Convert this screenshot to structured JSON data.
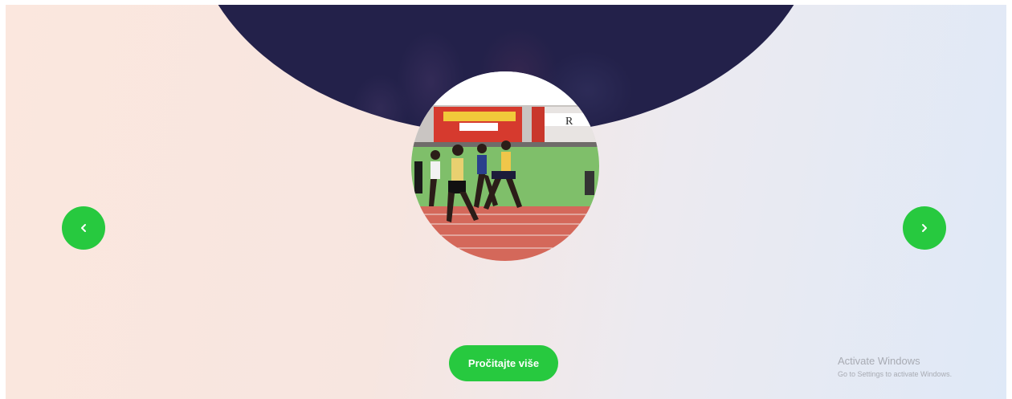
{
  "slider": {
    "read_more_label": "Pročitajte više",
    "prev_icon": "chevron-left-icon",
    "next_icon": "chevron-right-icon",
    "accent_color": "#27c93f",
    "dark_color": "#23214a"
  },
  "watermark": {
    "title": "Activate Windows",
    "subtitle": "Go to Settings to activate Windows."
  }
}
